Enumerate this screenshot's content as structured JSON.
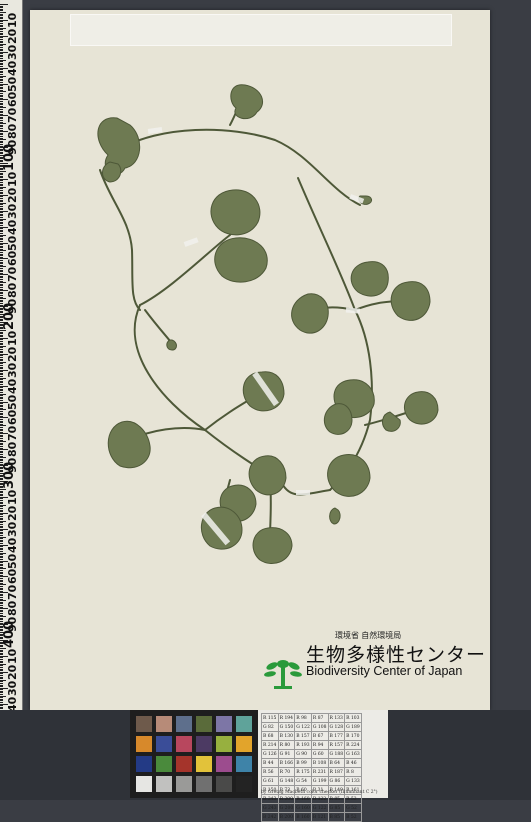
{
  "ruler": {
    "labels": [
      "10",
      "20",
      "30",
      "40",
      "50",
      "60",
      "70",
      "80",
      "90",
      "100",
      "10",
      "20",
      "30",
      "40",
      "50",
      "60",
      "70",
      "80",
      "90",
      "200",
      "10",
      "20",
      "30",
      "40",
      "50",
      "60",
      "70",
      "80",
      "90",
      "300",
      "10",
      "20",
      "30",
      "40",
      "50",
      "60",
      "70",
      "80",
      "90",
      "400",
      "10",
      "20",
      "30",
      "40",
      "50",
      "60",
      "70",
      "80",
      "90",
      "500"
    ]
  },
  "specimen": {
    "subject": "Centella asiatica herbarium specimen",
    "leaf_color": "#6e7a52",
    "stem_color": "#4e5838"
  },
  "logo": {
    "ministry": "環境省 自然環境局",
    "name_jp": "生物多様性センター",
    "name_en": "Biodiversity Center of Japan",
    "mark_color": "#2a9a3b"
  },
  "color_chart": {
    "swatches": [
      "#6e5a4b",
      "#b78b78",
      "#5e6f8c",
      "#5a6b3a",
      "#7d76a6",
      "#5fa39a",
      "#d7892b",
      "#3a4d98",
      "#b8475e",
      "#4c3a63",
      "#97b03f",
      "#e2a42b",
      "#233a85",
      "#4a8a3c",
      "#a5342b",
      "#e2c23a",
      "#9c4c8e",
      "#3e83a8",
      "#e6e6e3",
      "#c1c1bf",
      "#9a9a98",
      "#707070",
      "#4a4a49",
      "#232323"
    ]
  },
  "data_card": {
    "rows": [
      [
        "R 115",
        "R 194",
        "R 98",
        "R 87",
        "R 133",
        "R 103"
      ],
      [
        "G 82",
        "G 150",
        "G 122",
        "G 108",
        "G 128",
        "G 189"
      ],
      [
        "B 68",
        "B 130",
        "B 157",
        "B 67",
        "B 177",
        "B 170"
      ],
      [
        "R 214",
        "R 80",
        "R 193",
        "R 94",
        "R 157",
        "R 224"
      ],
      [
        "G 126",
        "G 91",
        "G 90",
        "G 60",
        "G 188",
        "G 163"
      ],
      [
        "B 44",
        "B 166",
        "B 99",
        "B 108",
        "B 64",
        "B 46"
      ],
      [
        "R 56",
        "R 70",
        "R 175",
        "R 231",
        "R 187",
        "R 8"
      ],
      [
        "G 61",
        "G 148",
        "G 54",
        "G 199",
        "G 86",
        "G 133"
      ],
      [
        "B 150",
        "B 73",
        "B 60",
        "B 31",
        "B 149",
        "B 161"
      ],
      [
        "R 243",
        "R 200",
        "R 160",
        "R 122",
        "R 85",
        "R 52"
      ],
      [
        "G 243",
        "G 200",
        "G 160",
        "G 122",
        "G 85",
        "G 52"
      ],
      [
        "B 242",
        "B 200",
        "B 160",
        "B 121",
        "B 85",
        "B 52"
      ]
    ],
    "caption": "by Gretag Macbeth color checker (Illuminant C 2°)"
  }
}
